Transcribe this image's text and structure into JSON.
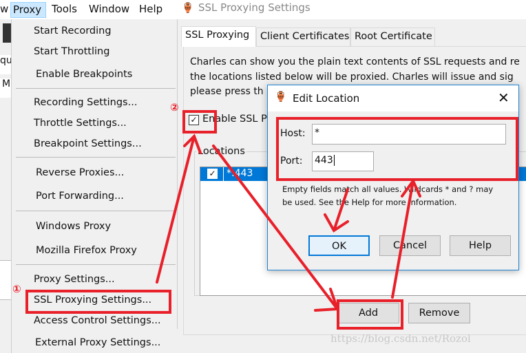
{
  "menubar": {
    "items": [
      "w",
      "Proxy",
      "Tools",
      "Window",
      "Help"
    ]
  },
  "proxy_menu": {
    "items": [
      "Start Recording",
      "Start Throttling",
      "Enable Breakpoints",
      "Recording Settings...",
      "Throttle Settings...",
      "Breakpoint Settings...",
      "Reverse Proxies...",
      "Port Forwarding...",
      "Windows Proxy",
      "Mozilla Firefox Proxy",
      "Proxy Settings...",
      "SSL Proxying Settings...",
      "Access Control Settings...",
      "External Proxy Settings..."
    ]
  },
  "left_strip": {
    "frag1": "qu",
    "frag2": "M"
  },
  "ssl_window": {
    "title": "SSL Proxying Settings",
    "tabs": [
      "SSL Proxying",
      "Client Certificates",
      "Root Certificate"
    ],
    "desc_lines": [
      "Charles can show you the plain text contents of SSL requests and re",
      "the locations listed below will be proxied. Charles will issue and sig",
      "please press th"
    ],
    "enable_label": "Enable SSL P",
    "enable_checked": true,
    "locations_label": "Locations",
    "locations": [
      {
        "checked": true,
        "location": "*:443"
      }
    ],
    "add_label": "Add",
    "remove_label": "Remove"
  },
  "edit_location": {
    "title": "Edit Location",
    "host_label": "Host:",
    "host_value": "*",
    "port_label": "Port:",
    "port_value": "443",
    "help_lines": [
      "Empty fields match all values. Wildcards * and ? may",
      "be used. See the Help for more information."
    ],
    "ok_label": "OK",
    "cancel_label": "Cancel",
    "help_label": "Help"
  },
  "annotations": {
    "step1": "①",
    "step2": "②",
    "color": "#e8202a"
  },
  "watermark": "https://blog.csdn.net/Rozol"
}
